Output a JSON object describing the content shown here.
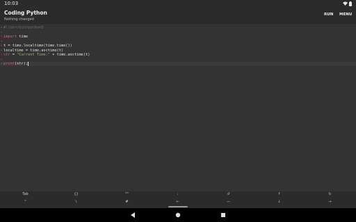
{
  "status_bar": {
    "time": "10:03"
  },
  "app_bar": {
    "title": "Coding Python",
    "subtitle": "Nothing changed",
    "run_label": "RUN",
    "menu_label": "MENU"
  },
  "editor": {
    "lines": [
      {
        "gutter": "1",
        "tokens": [
          {
            "t": "#!/usr/bin/python3",
            "c": "comment"
          }
        ]
      },
      {
        "gutter": "2",
        "tokens": []
      },
      {
        "gutter": "3",
        "tokens": [
          {
            "t": "import",
            "c": "keyword"
          },
          {
            "t": " time",
            "c": "plain"
          }
        ]
      },
      {
        "gutter": "4",
        "tokens": []
      },
      {
        "gutter": "5",
        "tokens": [
          {
            "t": "t = time.localtime(time.time())",
            "c": "plain"
          }
        ]
      },
      {
        "gutter": "6",
        "tokens": [
          {
            "t": "localtime = time.asctime(t)",
            "c": "plain"
          }
        ]
      },
      {
        "gutter": "7",
        "tokens": [
          {
            "t": "str",
            "c": "builtin"
          },
          {
            "t": " = ",
            "c": "plain"
          },
          {
            "t": "\"Current Time:\"",
            "c": "string"
          },
          {
            "t": " + time.asctime(t)",
            "c": "plain"
          }
        ]
      },
      {
        "gutter": "8",
        "tokens": []
      },
      {
        "gutter": "9",
        "tokens": [
          {
            "t": "print",
            "c": "builtin"
          },
          {
            "t": "(str);",
            "c": "plain"
          }
        ],
        "current": true
      }
    ]
  },
  "extra_keys": {
    "row1": [
      {
        "label": "Tab",
        "name": "tab-key"
      },
      {
        "label": "{}",
        "name": "braces-key"
      },
      {
        "label": "\"\"",
        "name": "quotes-key"
      },
      {
        "label": ":",
        "name": "colon-key"
      },
      {
        "label": "↺",
        "name": "undo-key"
      },
      {
        "label": "↑",
        "name": "arrow-up-key"
      },
      {
        "label": "↻",
        "name": "redo-key"
      }
    ],
    "row2": [
      {
        "label": "\"",
        "name": "quote-key"
      },
      {
        "label": "\\",
        "name": "backslash-key"
      },
      {
        "label": "#",
        "name": "hash-key"
      },
      {
        "label": "←",
        "name": "arrow-left-key"
      },
      {
        "label": "—",
        "name": "minus-key"
      },
      {
        "label": "↓",
        "name": "arrow-down-key"
      },
      {
        "label": "→",
        "name": "arrow-right-key"
      }
    ]
  },
  "nav_bar": {
    "icons": [
      "back-icon",
      "home-icon",
      "recents-icon"
    ]
  },
  "colors": {
    "background": "#2b2b2b",
    "editor_background": "#333333",
    "keyword": "#e85598",
    "string": "#8fbe5a",
    "comment": "#6e6e6e"
  }
}
